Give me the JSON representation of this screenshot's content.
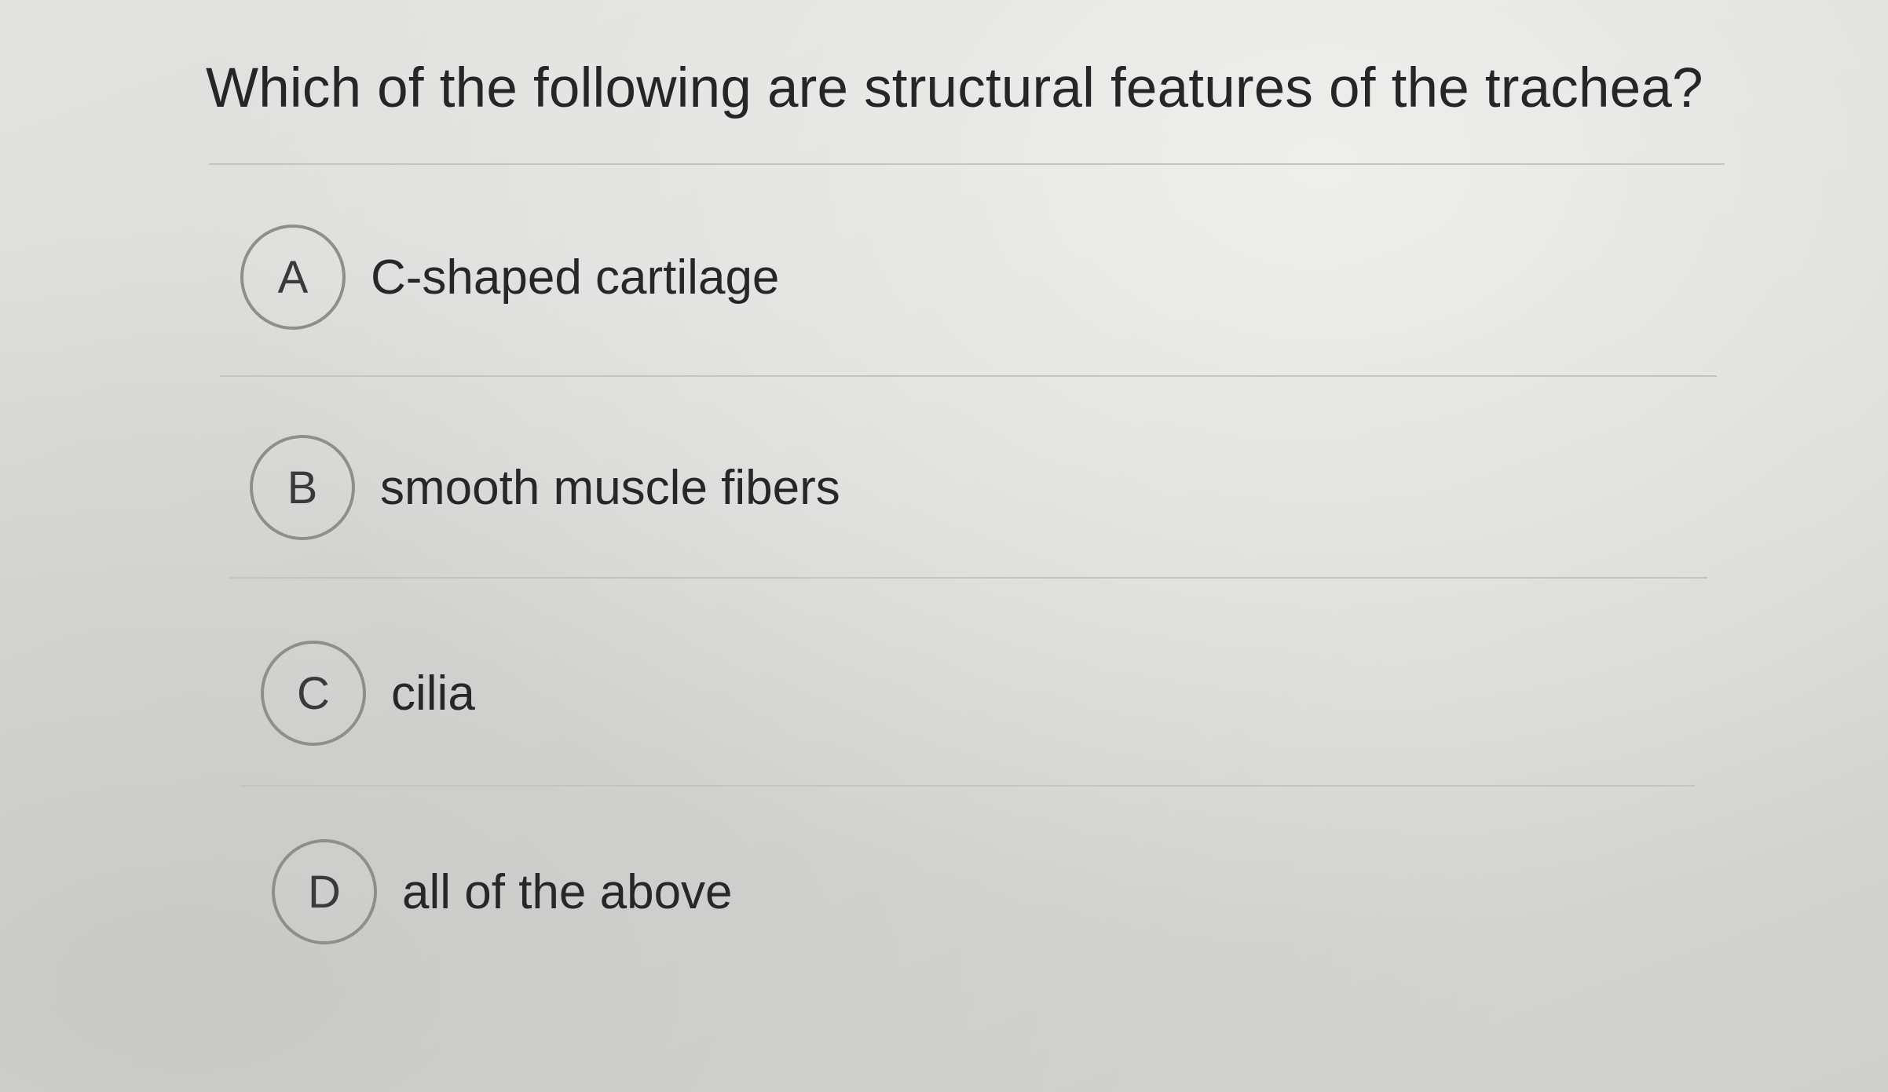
{
  "question": {
    "text": "Which of the following are structural features of the trachea?"
  },
  "options": [
    {
      "letter": "A",
      "text": "C-shaped cartilage"
    },
    {
      "letter": "B",
      "text": "smooth muscle fibers"
    },
    {
      "letter": "C",
      "text": "cilia"
    },
    {
      "letter": "D",
      "text": "all of the above"
    }
  ]
}
